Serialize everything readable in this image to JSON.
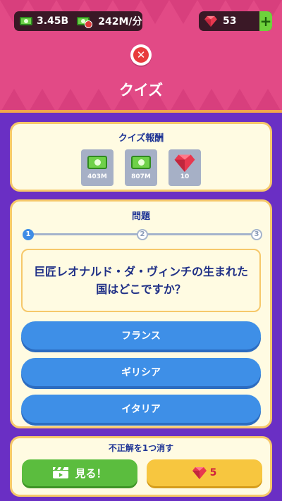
{
  "currency": {
    "cash": "3.45B",
    "rate": "242M/分",
    "gems": "53",
    "add_label": "+"
  },
  "header": {
    "close_label": "✕",
    "title": "クイズ"
  },
  "rewards": {
    "title": "クイズ報酬",
    "items": [
      {
        "icon": "cash-icon",
        "amount": "403M"
      },
      {
        "icon": "cash-icon",
        "amount": "807M"
      },
      {
        "icon": "gem-icon",
        "amount": "10"
      }
    ]
  },
  "question": {
    "title": "問題",
    "progress_steps": [
      "1",
      "2",
      "3"
    ],
    "current_step": 1,
    "text": "巨匠レオナルド・ダ・ヴィンチの生まれた国はどこですか？",
    "answers": [
      "フランス",
      "ギリシア",
      "イタリア"
    ]
  },
  "hint": {
    "title": "不正解を1つ消す",
    "watch_label": "見る！",
    "gem_cost": "5"
  },
  "colors": {
    "header": "#e24a86",
    "background": "#6a2fc4",
    "card": "#fffbe2",
    "answer_button": "#3e8fe7",
    "watch_button": "#5bbd3e",
    "gem_button": "#f7c63f"
  }
}
